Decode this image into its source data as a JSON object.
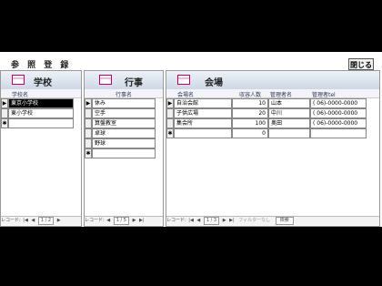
{
  "header": {
    "title": "参 照 登 録",
    "close_label": "閉じる"
  },
  "schools": {
    "title": "学校",
    "column": "学校名",
    "rows": [
      "東京小学校",
      "東小学校",
      ""
    ],
    "nav": {
      "label": "レコード:",
      "pos": "1 / 2"
    }
  },
  "events": {
    "title": "行事",
    "column": "行事名",
    "rows": [
      "休み",
      "空手",
      "算盤教室",
      "卓球",
      "野球",
      ""
    ],
    "nav": {
      "label": "レコード:",
      "pos": "1 / 5"
    }
  },
  "venues": {
    "title": "会場",
    "columns": {
      "name": "会場名",
      "capacity": "収容人数",
      "manager": "管理者名",
      "phone": "管理者tel"
    },
    "rows": [
      {
        "name": "自治会館",
        "capacity": "10",
        "manager": "山本",
        "phone": "( 06)-0000-0000"
      },
      {
        "name": "子供広場",
        "capacity": "20",
        "manager": "中川",
        "phone": "( 06)-0000-0000"
      },
      {
        "name": "集会所",
        "capacity": "100",
        "manager": "奥田",
        "phone": "( 06)-0000-0000"
      },
      {
        "name": "",
        "capacity": "0",
        "manager": "",
        "phone": ""
      }
    ],
    "nav": {
      "label": "レコード:",
      "pos": "1 / 3",
      "filter": "フィルターなし",
      "search": "検索"
    }
  },
  "icons": {
    "new_record": "new-record-icon",
    "current_record": "record-pointer-icon"
  }
}
